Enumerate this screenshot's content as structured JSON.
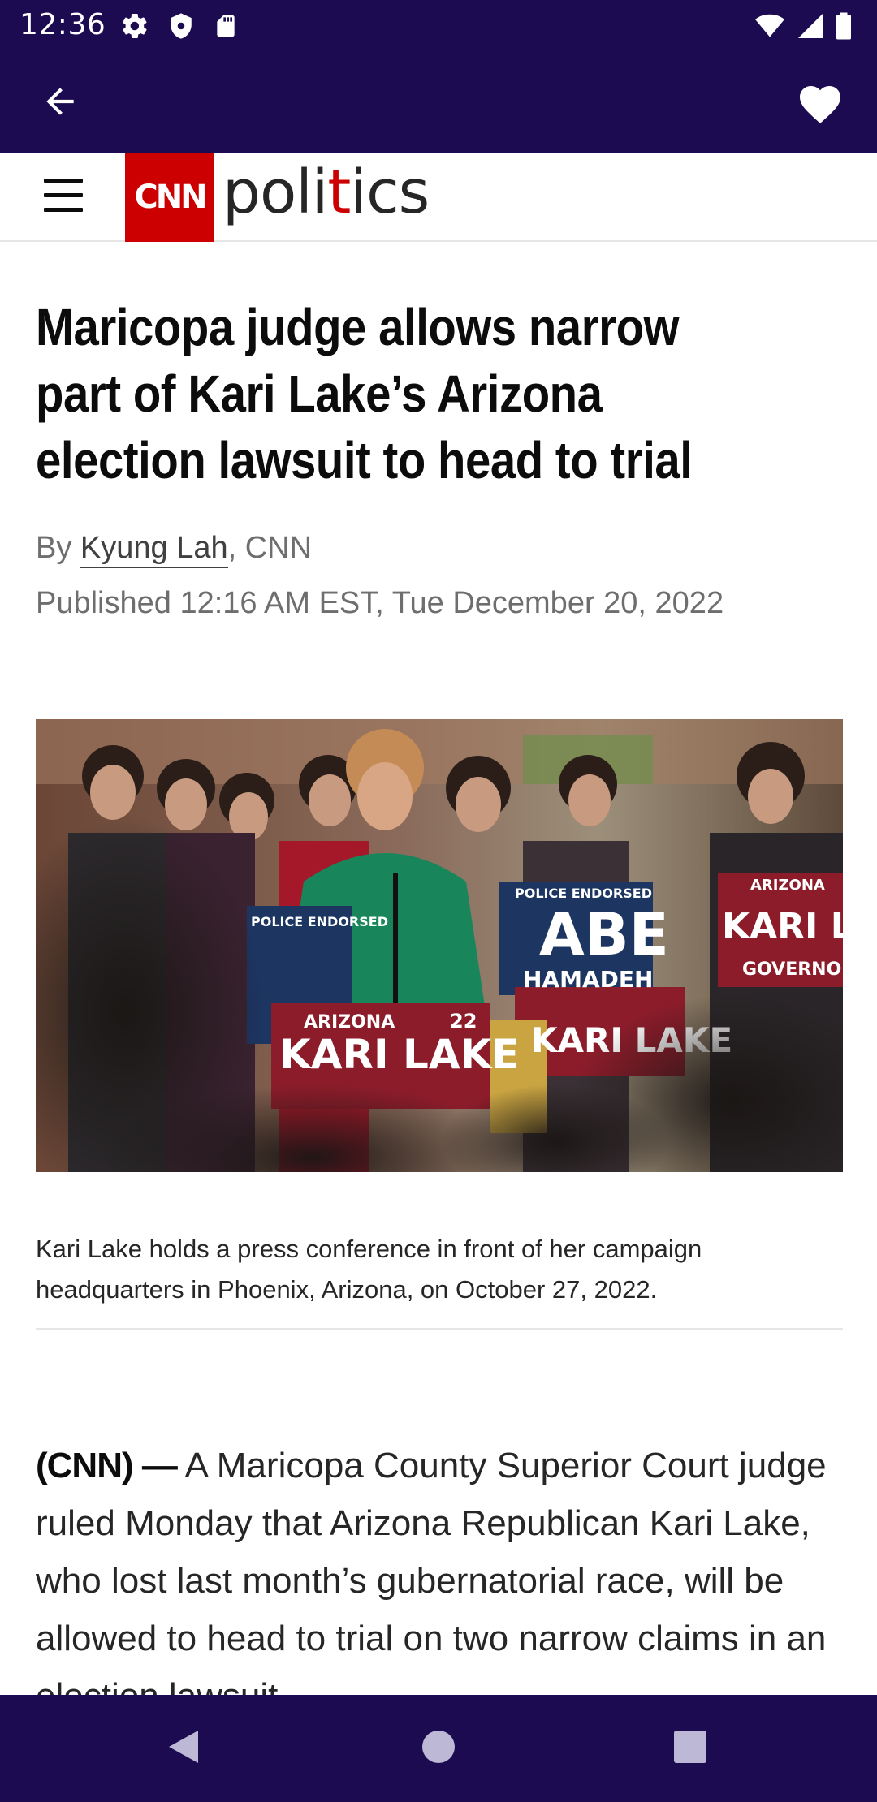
{
  "status_bar": {
    "time": "12:36",
    "left_icons": [
      "gear-icon",
      "shield-icon",
      "sd-card-icon"
    ],
    "right_icons": [
      "wifi-icon",
      "signal-icon",
      "battery-icon"
    ]
  },
  "app_bar": {
    "back_icon": "arrow-back-icon",
    "favorite_icon": "heart-icon"
  },
  "site_header": {
    "logo_text": "CNN",
    "section_prefix": "poli",
    "section_accent": "t",
    "section_mid": "i",
    "section_suffix": "cs"
  },
  "article": {
    "headline": "Maricopa judge allows narrow part of Kari Lake’s Arizona election lawsuit to head to trial",
    "byline_prefix": "By ",
    "author": "Kyung Lah",
    "byline_suffix": ", CNN",
    "published": "Published 12:16 AM EST, Tue December 20, 2022",
    "photo_caption": "Kari Lake holds a press conference in front of her campaign headquarters in Phoenix, Arizona, on October 27, 2022.",
    "dateline": "(CNN) —",
    "body": " A Maricopa County Superior Court judge ruled Monday that Arizona Republican Kari Lake, who lost last month’s gubernatorial race, will be allowed to head to trial on two narrow claims in an election lawsuit."
  },
  "photo_signs": {
    "sign_police": "POLICE ENDORSED",
    "sign_abe": "ABE",
    "sign_hamadeh": "HAMADEH",
    "sign_arizona": "ARIZONA",
    "sign_kari_lake": "KARI LAKE",
    "sign_governor": "GOVERNOR",
    "sign_year": "22"
  },
  "colors": {
    "bars": "#1d0b51",
    "cnn_red": "#cc0000"
  },
  "nav_bar": {
    "icons": [
      "nav-back-icon",
      "nav-home-icon",
      "nav-recents-icon"
    ]
  }
}
